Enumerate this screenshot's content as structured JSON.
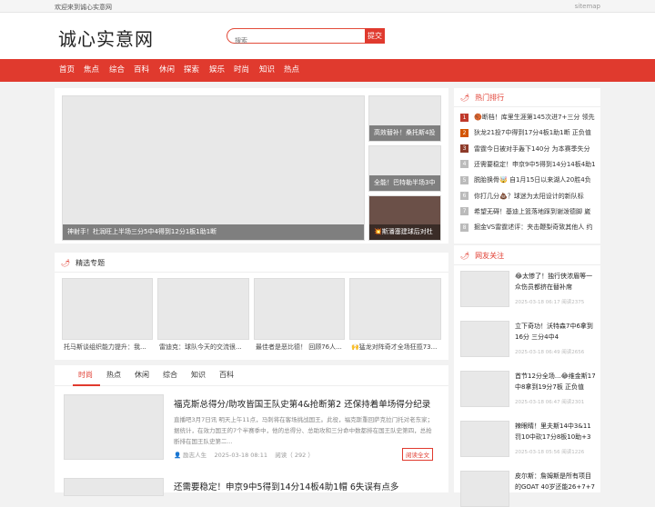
{
  "topbar": {
    "welcome": "欢迎来到诚心实意网",
    "sitemap": "sitemap"
  },
  "header": {
    "logo": "诚心实意网",
    "search_placeholder": "搜索",
    "search_btn": "提交"
  },
  "nav": [
    "首页",
    "焦点",
    "综合",
    "百科",
    "休闲",
    "探索",
    "娱乐",
    "时尚",
    "知识",
    "热点"
  ],
  "banner": {
    "main_caption": "神射手！杜润旺上半场三分5中4得到12分1板1助1断",
    "side": [
      {
        "caption": "高效替补！桑托斯4投"
      },
      {
        "caption": "全能！巴特勒半场3中"
      },
      {
        "caption": "💥斯潘塞建球后对杜"
      }
    ]
  },
  "hot": {
    "title": "热门排行",
    "items": [
      {
        "n": "1",
        "text": "🏀断档！库里生涯第145次进7+三分 领先",
        "color": "#c0392b"
      },
      {
        "n": "2",
        "text": "狄龙21投7中得到17分4板1助1断 正负值",
        "color": "#d35400"
      },
      {
        "n": "3",
        "text": "雷霆今日被对手轰下140分 为本赛季失分",
        "color": "#8e3b2a"
      },
      {
        "n": "4",
        "text": "还需要稳定！申京9中5得到14分14板4助1",
        "color": "#bbbbbb"
      },
      {
        "n": "5",
        "text": "脱胎换骨🤯 自1月15日以来湖人20胜4负",
        "color": "#bbbbbb"
      },
      {
        "n": "6",
        "text": "你打几分💩？球迷为太阳设计的新队标",
        "color": "#bbbbbb"
      },
      {
        "n": "7",
        "text": "希望无碍！基迪上篮落地踩到谢泼德脚 崴",
        "color": "#bbbbbb"
      },
      {
        "n": "8",
        "text": "掘金VS雷霆述评：夹击鞭梨奇致其他人 约",
        "color": "#bbbbbb"
      }
    ]
  },
  "featured": {
    "title": "精选专题",
    "items": [
      "托马斯谈组织能力提升：我...",
      "雷迪克：球队今天的交流很...",
      "最佳者是恶比德！ 回顾76人...",
      "🙌猛龙对阵奇才全场狂揽73..."
    ]
  },
  "tabs": [
    "时尚",
    "热点",
    "休闲",
    "综合",
    "知识",
    "百科"
  ],
  "articles": [
    {
      "title": "福克斯总得分/助攻皆国王队史第4&抢断第2 还保持着单场得分纪录",
      "summary": "直播吧3月7日讯 明天上午11点，马刺将在客场挑战国王。此役，福克斯重回萨克拉门托对老东家；据统计，在效力国王的7个半赛季中，他的总得分、总助攻和三分命中数都排在国王队史第四，总抢断排在国王队史第二...",
      "author": "励志人生",
      "date": "2025-03-18 08:11",
      "reads_label": "阅读",
      "reads": "292",
      "btn": "阅读全文"
    },
    {
      "title": "还需要稳定！申京9中5得到14分14板4助1帽 6失误有点多"
    }
  ],
  "friends": {
    "title": "网友关注",
    "items": [
      {
        "title": "😂太惨了！独行侠浓眉等一众伤员都挤在替补席",
        "meta": "2025-03-18 06:17   阅读2375"
      },
      {
        "title": "立下奇功！沃特森7中6拿到16分 三分4中4",
        "meta": "2025-03-18 06:49   阅读2656"
      },
      {
        "title": "首节12分全场...😂维金斯17中8拿到19分7板 正负值",
        "meta": "2025-03-18 06:47   阅读2301"
      },
      {
        "title": "辣眼睛！里夫斯14中3&11罚10中砍17分8板10助+3失",
        "meta": "2025-03-18 05:56   阅读1226"
      },
      {
        "title": "皮尔斯：詹姆斯是所有项目的GOAT 40岁还能26+7+7",
        "meta": ""
      }
    ]
  }
}
